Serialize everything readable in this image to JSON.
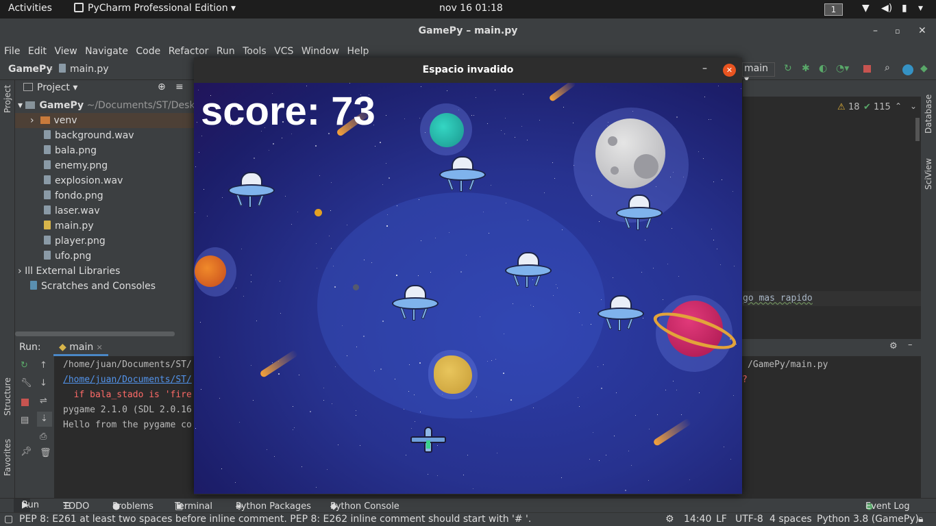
{
  "topbar": {
    "activities": "Activities",
    "app_menu": "PyCharm Professional Edition",
    "clock": "nov 16  01:18",
    "workspace": "1"
  },
  "window": {
    "title": "GamePy – main.py"
  },
  "menu": [
    "File",
    "Edit",
    "View",
    "Navigate",
    "Code",
    "Refactor",
    "Run",
    "Tools",
    "VCS",
    "Window",
    "Help"
  ],
  "nav": {
    "project": "GamePy",
    "file": "main.py",
    "run_config": "main"
  },
  "project_panel": {
    "header": "Project",
    "root": "GamePy",
    "root_path": "~/Documents/ST/Desk",
    "items": [
      "venv",
      "background.wav",
      "bala.png",
      "enemy.png",
      "explosion.wav",
      "fondo.png",
      "laser.wav",
      "main.py",
      "player.png",
      "ufo.png"
    ],
    "external": "External Libraries",
    "scratches": "Scratches and Consoles"
  },
  "editor": {
    "warnings": "18",
    "weak_warnings": "115",
    "code_fragment": "go mas rapido"
  },
  "right_stripe": [
    "Database",
    "SciView"
  ],
  "left_stripe": [
    "Project",
    "Structure",
    "Favorites"
  ],
  "run": {
    "label": "Run:",
    "tab": "main",
    "lines": [
      "/home/juan/Documents/ST/",
      "/home/juan/Documents/ST/",
      "  if bala_stado is 'fire",
      "pygame 2.1.0 (SDL 2.0.16",
      "Hello from the pygame co"
    ],
    "right_fragment_1": "/GamePy/main.py",
    "right_fragment_2": "?"
  },
  "bottom_tools": [
    "Run",
    "TODO",
    "Problems",
    "Terminal",
    "Python Packages",
    "Python Console",
    "Event Log"
  ],
  "status": {
    "message": "PEP 8: E261 at least two spaces before inline comment. PEP 8: E262 inline comment should start with '# '.",
    "position": "14:40",
    "line_sep": "LF",
    "encoding": "UTF-8",
    "indent": "4 spaces",
    "interpreter": "Python 3.8 (GamePy)"
  },
  "game": {
    "title": "Espacio invadido",
    "score": "score: 73"
  }
}
